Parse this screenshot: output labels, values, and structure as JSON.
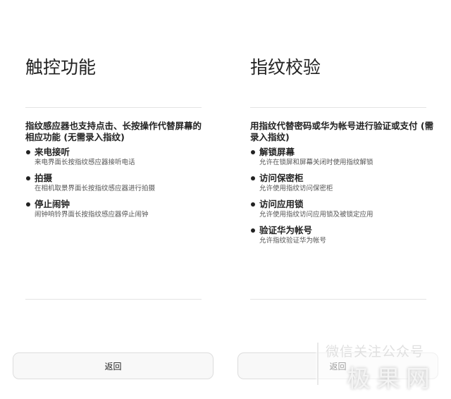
{
  "left": {
    "title": "触控功能",
    "heading": "指纹感应器也支持点击、长按操作代替屏幕的相应功能 (无需录入指纹)",
    "items": [
      {
        "title": "来电接听",
        "desc": "来电界面长按指纹感应器接听电话"
      },
      {
        "title": "拍摄",
        "desc": "在相机取景界面长按指纹感应器进行拍摄"
      },
      {
        "title": "停止闹钟",
        "desc": "闹钟响铃界面长按指纹感应器停止闹钟"
      }
    ],
    "back_label": "返回"
  },
  "right": {
    "title": "指纹校验",
    "heading": "用指纹代替密码或华为帐号进行验证或支付 (需录入指纹)",
    "items": [
      {
        "title": "解锁屏幕",
        "desc": "允许在锁屏和屏幕关闭时使用指纹解锁"
      },
      {
        "title": "访问保密柜",
        "desc": "允许使用指纹访问保密柜"
      },
      {
        "title": "访问应用锁",
        "desc": "允许使用指纹访问应用锁及被锁定应用"
      },
      {
        "title": "验证华为帐号",
        "desc": "允许指纹验证华为帐号"
      }
    ],
    "back_label": "返回"
  },
  "watermark": {
    "line1": "微信关注公众号",
    "line2": "极果网"
  }
}
